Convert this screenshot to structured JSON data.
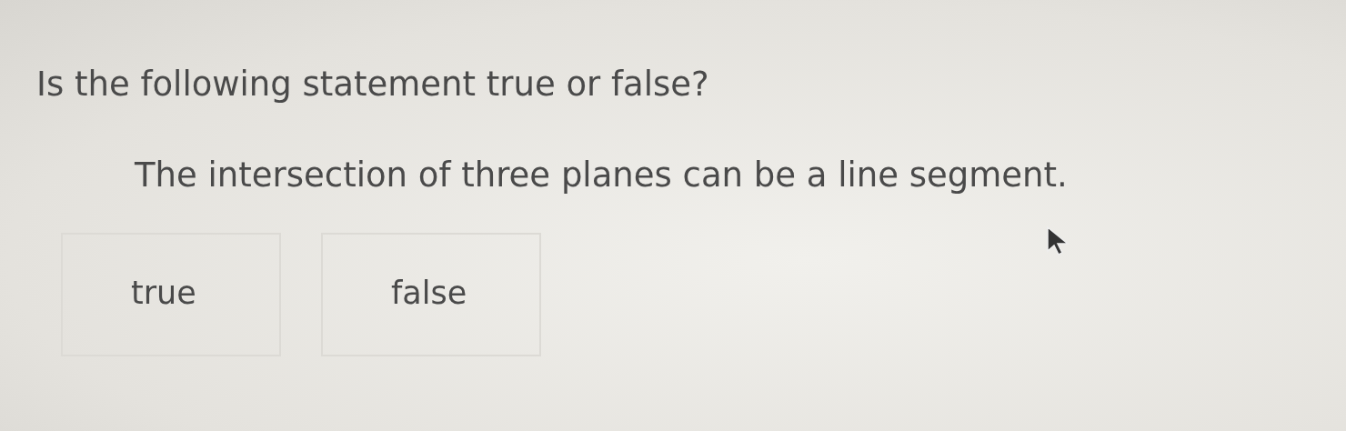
{
  "question": "Is the following statement true or false?",
  "statement": "The intersection of three planes can be a line segment.",
  "options": [
    {
      "label": "true",
      "selected": false
    },
    {
      "label": "false",
      "selected": false
    }
  ]
}
